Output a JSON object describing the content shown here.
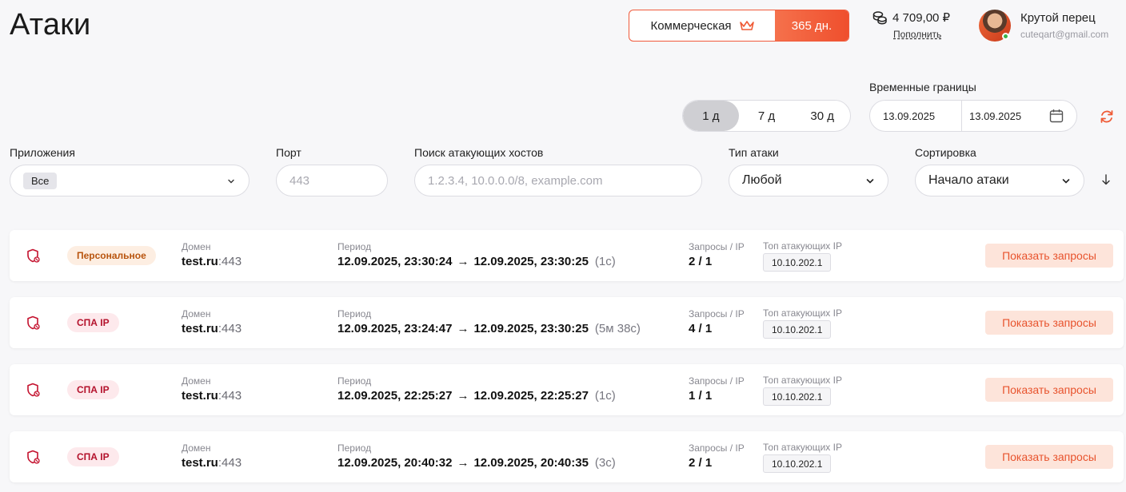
{
  "header": {
    "title": "Атаки",
    "plan": {
      "name": "Коммерческая",
      "days": "365 дн."
    },
    "balance": {
      "amount": "4 709,00 ₽",
      "topup_label": "Пополнить"
    },
    "user": {
      "name": "Крутой перец",
      "email": "cuteqart@gmail.com"
    }
  },
  "time_range": {
    "label": "Временные границы",
    "options": [
      "1 д",
      "7 д",
      "30 д"
    ],
    "selected": "1 д",
    "from": "13.09.2025",
    "to": "13.09.2025"
  },
  "filters": {
    "apps": {
      "label": "Приложения",
      "value": "Все"
    },
    "port": {
      "label": "Порт",
      "placeholder": "443"
    },
    "search": {
      "label": "Поиск атакующих хостов",
      "placeholder": "1.2.3.4, 10.0.0.0/8, example.com"
    },
    "attack_type": {
      "label": "Тип атаки",
      "value": "Любой"
    },
    "sort": {
      "label": "Сортировка",
      "value": "Начало атаки"
    }
  },
  "labels": {
    "domain": "Домен",
    "period": "Период",
    "requests": "Запросы / IP",
    "top_ips": "Топ атакующих IP",
    "show_requests": "Показать запросы",
    "arrow": "→"
  },
  "attacks": [
    {
      "type": "Персональное",
      "kind": "personal",
      "domain": "test.ru",
      "port": ":443",
      "start": "12.09.2025, 23:30:24",
      "end": "12.09.2025, 23:30:25",
      "duration": "(1с)",
      "requests": "2 / 1",
      "top_ip": "10.10.202.1"
    },
    {
      "type": "СПА IP",
      "kind": "spa",
      "domain": "test.ru",
      "port": ":443",
      "start": "12.09.2025, 23:24:47",
      "end": "12.09.2025, 23:30:25",
      "duration": "(5м 38с)",
      "requests": "4 / 1",
      "top_ip": "10.10.202.1"
    },
    {
      "type": "СПА IP",
      "kind": "spa",
      "domain": "test.ru",
      "port": ":443",
      "start": "12.09.2025, 22:25:27",
      "end": "12.09.2025, 22:25:27",
      "duration": "(1с)",
      "requests": "1 / 1",
      "top_ip": "10.10.202.1"
    },
    {
      "type": "СПА IP",
      "kind": "spa",
      "domain": "test.ru",
      "port": ":443",
      "start": "12.09.2025, 20:40:32",
      "end": "12.09.2025, 20:40:35",
      "duration": "(3с)",
      "requests": "2 / 1",
      "top_ip": "10.10.202.1"
    }
  ],
  "colors": {
    "accent": "#ef5a35",
    "personal_badge": "#b8540e",
    "spa_badge": "#b4122c"
  }
}
